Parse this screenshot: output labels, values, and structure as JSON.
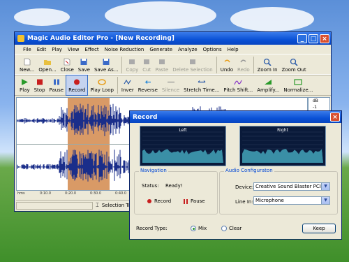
{
  "window": {
    "title": "Magic Audio Editor Pro - [New Recording]",
    "controls": {
      "minimize": "_",
      "maximize": "□",
      "close": "×"
    }
  },
  "menu": [
    "File",
    "Edit",
    "Play",
    "View",
    "Effect",
    "Noise Reduction",
    "Generate",
    "Analyze",
    "Options",
    "Help"
  ],
  "toolbar1": [
    {
      "label": "New...",
      "icon": "new-file-icon",
      "disabled": false
    },
    {
      "label": "Open...",
      "icon": "open-folder-icon",
      "disabled": false
    },
    {
      "label": "Close",
      "icon": "close-file-icon",
      "disabled": false
    },
    {
      "label": "Save",
      "icon": "save-icon",
      "disabled": false
    },
    {
      "label": "Save As...",
      "icon": "save-as-icon",
      "disabled": false
    },
    {
      "label": "Copy",
      "icon": "copy-icon",
      "disabled": true
    },
    {
      "label": "Cut",
      "icon": "cut-icon",
      "disabled": true
    },
    {
      "label": "Paste",
      "icon": "paste-icon",
      "disabled": true
    },
    {
      "label": "Delete Selection",
      "icon": "delete-icon",
      "disabled": true
    },
    {
      "label": "Undo",
      "icon": "undo-icon",
      "disabled": false
    },
    {
      "label": "Redo",
      "icon": "redo-icon",
      "disabled": true
    },
    {
      "label": "Zoom In",
      "icon": "zoom-in-icon",
      "disabled": false
    },
    {
      "label": "Zoom Out",
      "icon": "zoom-out-icon",
      "disabled": false
    }
  ],
  "toolbar2": [
    {
      "label": "Play",
      "icon": "play-icon",
      "disabled": false
    },
    {
      "label": "Stop",
      "icon": "stop-icon",
      "disabled": false
    },
    {
      "label": "Pause",
      "icon": "pause-icon",
      "disabled": false
    },
    {
      "label": "Record",
      "icon": "record-icon",
      "disabled": false,
      "selected": true
    },
    {
      "label": "Play Loop",
      "icon": "play-loop-icon",
      "disabled": false
    },
    {
      "label": "Inver",
      "icon": "invert-icon",
      "disabled": false
    },
    {
      "label": "Reverse",
      "icon": "reverse-icon",
      "disabled": false
    },
    {
      "label": "Silence",
      "icon": "silence-icon",
      "disabled": true
    },
    {
      "label": "Stretch Time...",
      "icon": "stretch-time-icon",
      "disabled": false
    },
    {
      "label": "Pitch Shift...",
      "icon": "pitch-shift-icon",
      "disabled": false
    },
    {
      "label": "Amplify...",
      "icon": "amplify-icon",
      "disabled": false
    },
    {
      "label": "Normalize...",
      "icon": "normalize-icon",
      "disabled": false
    }
  ],
  "db_scale": [
    "dB",
    "-1",
    "-2",
    "-4"
  ],
  "ruler": [
    "hms",
    "0:10.0",
    "0:20.0",
    "0:30.0",
    "0:40.0"
  ],
  "status": {
    "tool": "Selection Tool"
  },
  "dialog": {
    "title": "Record",
    "left_label": "Left",
    "right_label": "Right",
    "navigation": {
      "legend": "Navigation",
      "status_label": "Status:",
      "status_value": "Ready!",
      "record_label": "Record",
      "pause_label": "Pause"
    },
    "audio_config": {
      "legend": "Audio Configuraton",
      "device_label": "Device:",
      "device_value": "Creative Sound Blaster PCI",
      "line_label": "Line In:",
      "line_value": "Microphone"
    },
    "record_type": {
      "label": "Record Type:",
      "mix_label": "Mix",
      "clear_label": "Clear",
      "selected": "Mix"
    },
    "keep_label": "Keep"
  },
  "colors": {
    "selection": "#d99a66",
    "waveform": "#1a2e8a",
    "scope_bg": "#0a1a3a",
    "scope_fill": "#3a8fa6",
    "title_blue": "#0a51d6"
  }
}
